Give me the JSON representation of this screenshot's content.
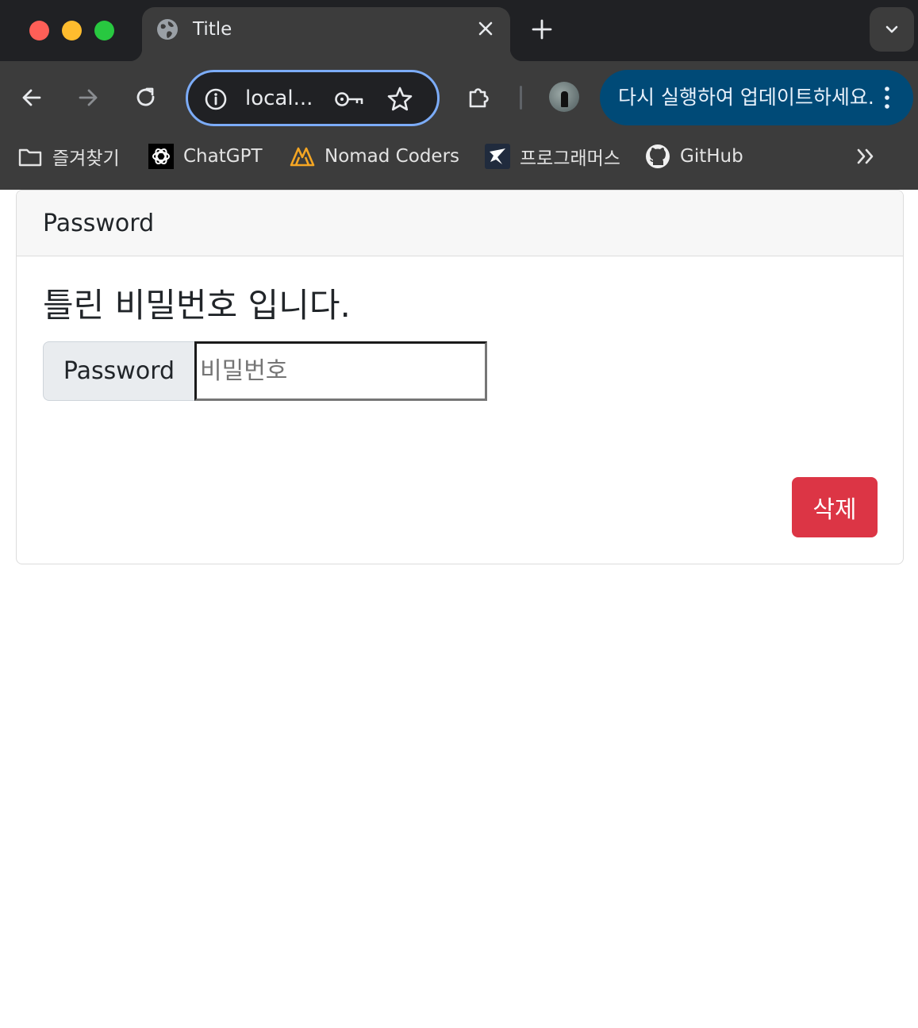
{
  "browser": {
    "traffic_lights": [
      {
        "name": "close",
        "color": "#ff5f57"
      },
      {
        "name": "minimize",
        "color": "#febc2e"
      },
      {
        "name": "maximize",
        "color": "#28c840"
      }
    ],
    "tab": {
      "title": "Title",
      "icon": "globe-icon"
    },
    "new_tab_icon": "plus-icon",
    "tab_search_icon": "chevron-down-icon",
    "omnibox": {
      "text": "local...",
      "icons": [
        "info-icon",
        "key-icon",
        "star-icon"
      ]
    },
    "update_button": {
      "label": "다시 실행하여 업데이트하세요.",
      "color": "#004a77"
    },
    "bookmarks": [
      {
        "label": "즐겨찾기",
        "icon": "folder-icon"
      },
      {
        "label": "ChatGPT",
        "icon": "chatgpt-icon"
      },
      {
        "label": "Nomad Coders",
        "icon": "nomad-coders-icon"
      },
      {
        "label": "프로그래머스",
        "icon": "programmers-icon"
      },
      {
        "label": "GitHub",
        "icon": "github-icon"
      }
    ]
  },
  "page": {
    "card_header": "Password",
    "error_message": "틀린 비밀번호 입니다.",
    "password_addon": "Password",
    "password_placeholder": "비밀번호",
    "password_value": "",
    "delete_button": "삭제",
    "colors": {
      "danger": "#dc3545",
      "addon_bg": "#e9ecef",
      "header_bg": "#f7f7f7"
    }
  }
}
